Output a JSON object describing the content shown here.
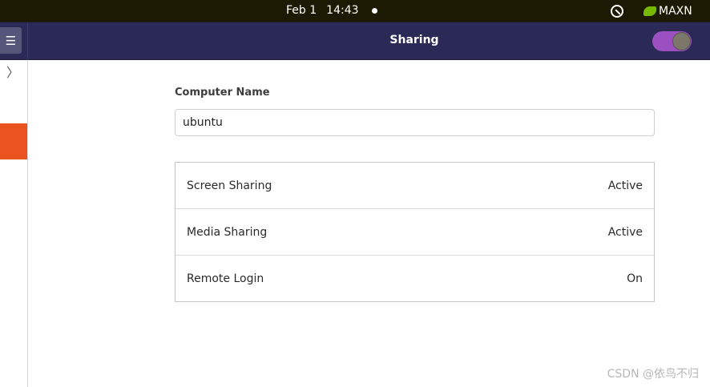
{
  "topbar": {
    "date": "Feb 1",
    "time": "14:43",
    "nvidia_mode": "MAXN"
  },
  "header": {
    "title": "Sharing",
    "menu_icon": "☰",
    "sharing_switch_on": true,
    "accent_color": "#9b4fc1"
  },
  "sidebar": {
    "expand_icon": "〉",
    "active_color": "#e95420"
  },
  "main": {
    "computer_name_label": "Computer Name",
    "computer_name_value": "ubuntu",
    "services": [
      {
        "name": "Screen Sharing",
        "status": "Active"
      },
      {
        "name": "Media Sharing",
        "status": "Active"
      },
      {
        "name": "Remote Login",
        "status": "On"
      }
    ]
  },
  "watermark": "CSDN @依鸟不归"
}
